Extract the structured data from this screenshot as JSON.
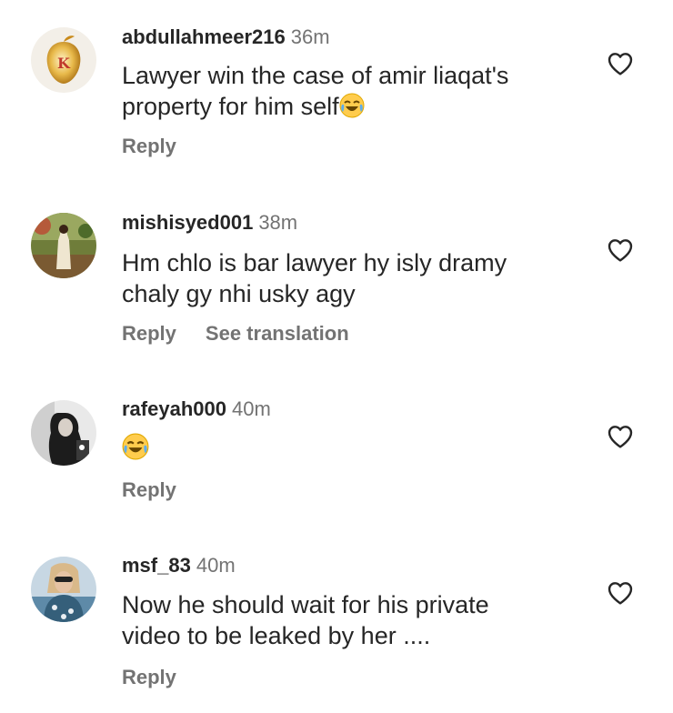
{
  "comments": [
    {
      "username": "abdullahmeer216",
      "time": "36m",
      "text": "Lawyer win the case of amir liaqat's\nproperty for him self",
      "emoji": "😂",
      "reply_label": "Reply"
    },
    {
      "username": "mishisyed001",
      "time": "38m",
      "text": "Hm chlo is bar lawyer hy isly dramy\nchaly gy nhi usky agy",
      "reply_label": "Reply",
      "translation_label": "See translation"
    },
    {
      "username": "rafeyah000",
      "time": "40m",
      "text": "",
      "emoji": "😂",
      "reply_label": "Reply"
    },
    {
      "username": "msf_83",
      "time": "40m",
      "text": "Now he should wait for his private\nvideo to be leaked by her ....",
      "reply_label": "Reply"
    }
  ],
  "icons": {
    "like": "heart-outline-icon",
    "emoji": "face-with-tears-of-joy"
  },
  "colors": {
    "text": "#262626",
    "secondary": "#737373",
    "background": "#ffffff"
  }
}
